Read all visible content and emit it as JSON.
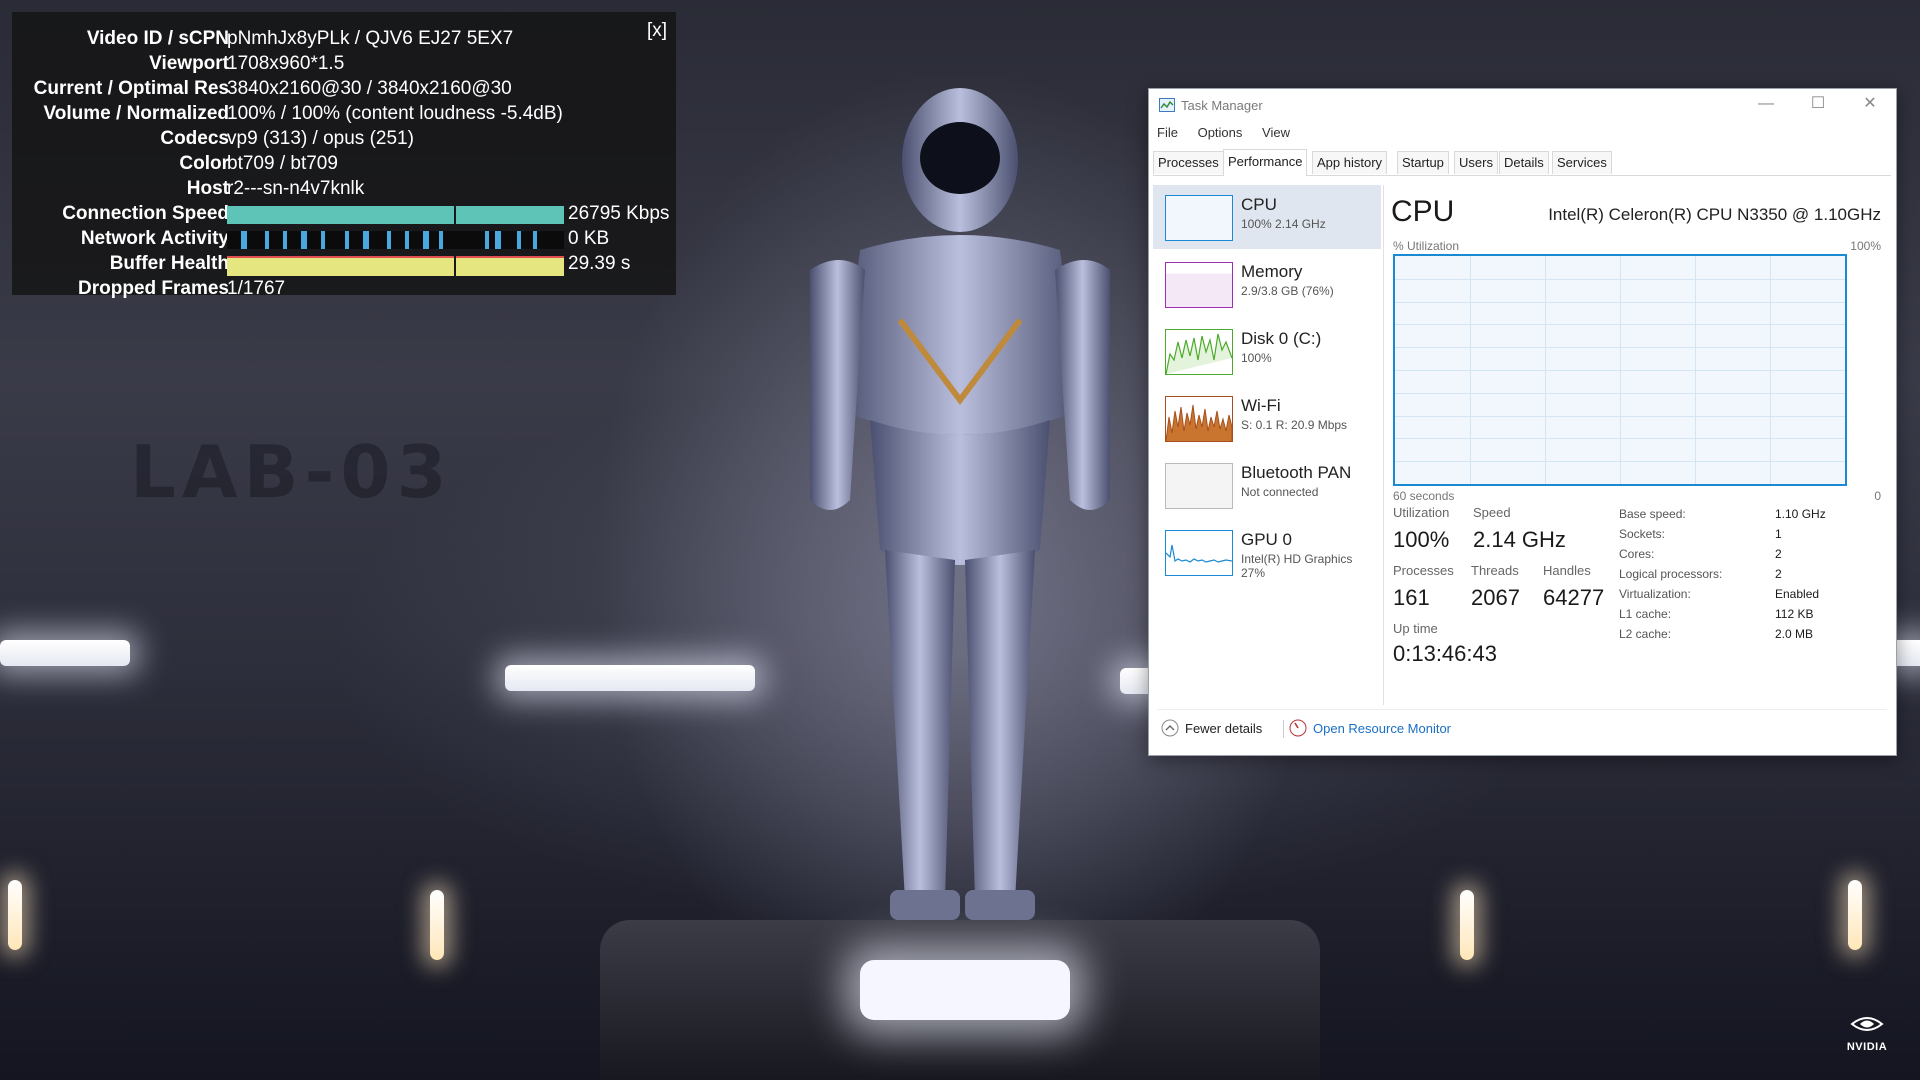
{
  "stats": {
    "close_label": "[x]",
    "rows": [
      {
        "key": "Video ID / sCPN",
        "value": "pNmhJx8yPLk / QJV6 EJ27 5EX7"
      },
      {
        "key": "Viewport",
        "value": "1708x960*1.5"
      },
      {
        "key": "Current / Optimal Res",
        "value": "3840x2160@30 / 3840x2160@30"
      },
      {
        "key": "Volume / Normalized",
        "value": "100% / 100% (content loudness -5.4dB)"
      },
      {
        "key": "Codecs",
        "value": "vp9 (313) / opus (251)"
      },
      {
        "key": "Color",
        "value": "bt709 / bt709"
      },
      {
        "key": "Host",
        "value": "r2---sn-n4v7knlk"
      },
      {
        "key": "Connection Speed",
        "value": "26795 Kbps"
      },
      {
        "key": "Network Activity",
        "value": "0 KB"
      },
      {
        "key": "Buffer Health",
        "value": "29.39 s"
      },
      {
        "key": "Dropped Frames",
        "value": "1/1767"
      }
    ],
    "colors": {
      "connection": "#5fc4b8",
      "network": "#4aa8e0",
      "buffer": "#e6e680",
      "buffer_line": "#e05050"
    }
  },
  "taskmanager": {
    "title": "Task Manager",
    "window_buttons": [
      "—",
      "☐",
      "✕"
    ],
    "menu": [
      "File",
      "Options",
      "View"
    ],
    "tabs": [
      "Processes",
      "Performance",
      "App history",
      "Startup",
      "Users",
      "Details",
      "Services"
    ],
    "active_tab": "Performance",
    "sidebar": [
      {
        "name": "CPU",
        "sub": "100% 2.14 GHz",
        "sub2": "",
        "color": "#1a8ad4"
      },
      {
        "name": "Memory",
        "sub": "2.9/3.8 GB (76%)",
        "sub2": "",
        "color": "#9b30b0"
      },
      {
        "name": "Disk 0 (C:)",
        "sub": "100%",
        "sub2": "",
        "color": "#4caa2a"
      },
      {
        "name": "Wi-Fi",
        "sub": "S: 0.1 R: 20.9 Mbps",
        "sub2": "",
        "color": "#a7501d"
      },
      {
        "name": "Bluetooth PAN",
        "sub": "Not connected",
        "sub2": "",
        "color": "#888888"
      },
      {
        "name": "GPU 0",
        "sub": "Intel(R) HD Graphics",
        "sub2": "27%",
        "color": "#1a8ad4"
      }
    ],
    "main": {
      "heading": "CPU",
      "model": "Intel(R) Celeron(R) CPU N3350 @ 1.10GHz",
      "util_label": "% Utilization",
      "util_max": "100%",
      "time_left": "60 seconds",
      "time_right": "0",
      "utilization_label": "Utilization",
      "utilization": "100%",
      "speed_label": "Speed",
      "speed": "2.14 GHz",
      "processes_label": "Processes",
      "processes": "161",
      "threads_label": "Threads",
      "threads": "2067",
      "handles_label": "Handles",
      "handles": "64277",
      "uptime_label": "Up time",
      "uptime": "0:13:46:43",
      "specs": [
        {
          "label": "Base speed:",
          "value": "1.10 GHz"
        },
        {
          "label": "Sockets:",
          "value": "1"
        },
        {
          "label": "Cores:",
          "value": "2"
        },
        {
          "label": "Logical processors:",
          "value": "2"
        },
        {
          "label": "Virtualization:",
          "value": "Enabled"
        },
        {
          "label": "L1 cache:",
          "value": "112 KB"
        },
        {
          "label": "L2 cache:",
          "value": "2.0 MB"
        }
      ]
    },
    "footer": {
      "fewer": "Fewer details",
      "monitor": "Open Resource Monitor"
    }
  },
  "scene": {
    "wall_text": "LAB-03",
    "watermark": "NVIDIA"
  }
}
